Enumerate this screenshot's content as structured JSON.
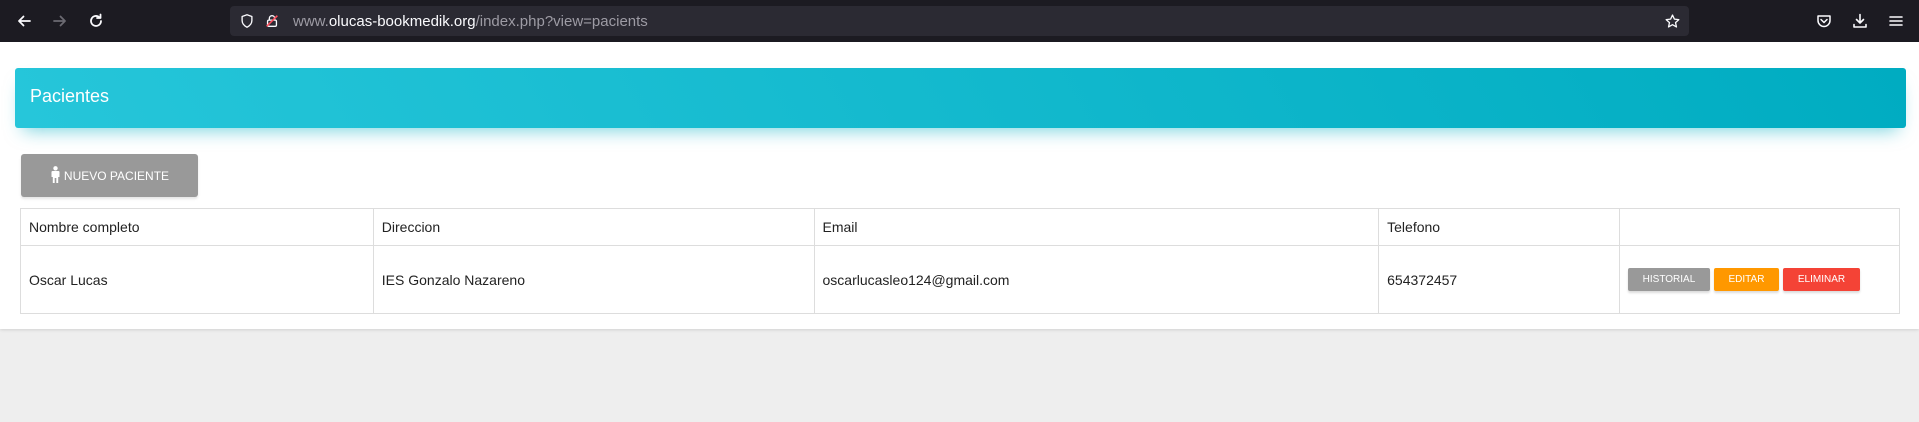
{
  "browser": {
    "url_prefix": "www.",
    "url_host": "olucas-bookmedik.org",
    "url_path": "/index.php?view=pacients",
    "icons": [
      "back-arrow-icon",
      "forward-arrow-icon",
      "reload-icon",
      "shield-icon",
      "lock-icon",
      "star-icon",
      "pocket-icon",
      "download-icon",
      "menu-icon"
    ]
  },
  "card": {
    "title": "Pacientes",
    "accent_colors": [
      "#26c6da",
      "#00acc1"
    ]
  },
  "new_patient_button": {
    "label": "NUEVO PACIENTE",
    "icon": "person-icon"
  },
  "table": {
    "headers": [
      "Nombre completo",
      "Direccion",
      "Email",
      "Telefono",
      ""
    ],
    "rows": [
      {
        "name": "Oscar Lucas",
        "address": "IES Gonzalo Nazareno",
        "email": "oscarlucasleo124@gmail.com",
        "phone": "654372457",
        "actions": {
          "history": "HISTORIAL",
          "edit": "EDITAR",
          "delete": "ELIMINAR"
        }
      }
    ]
  },
  "colors": {
    "history": "#999999",
    "edit": "#ff9800",
    "delete": "#f44336"
  }
}
